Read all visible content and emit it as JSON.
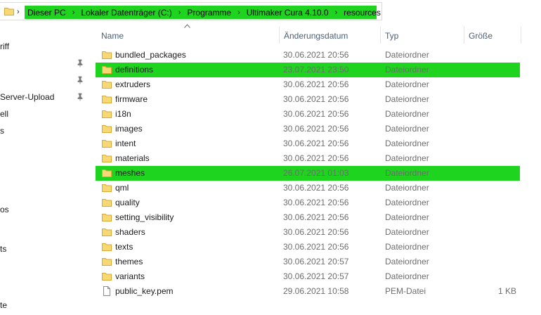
{
  "address_bar": {
    "crumbs": [
      "Dieser PC",
      "Lokaler Datenträger (C:)",
      "Programme",
      "Ultimaker Cura 4.10.0",
      "resources"
    ],
    "highlight_color": "#1ed41e"
  },
  "nav_pane": {
    "items": [
      {
        "label": "riff",
        "pinned": false
      },
      {
        "label": "",
        "pinned": true
      },
      {
        "label": "",
        "pinned": true
      },
      {
        "label": "Server-Upload",
        "pinned": true
      },
      {
        "label": "ell",
        "pinned": false
      },
      {
        "label": "s",
        "pinned": false
      },
      {
        "label": "os",
        "pinned": false
      },
      {
        "label": "ts",
        "pinned": false
      },
      {
        "label": "te",
        "pinned": false
      }
    ]
  },
  "columns": {
    "name": "Name",
    "date": "Änderungsdatum",
    "type": "Typ",
    "size": "Größe"
  },
  "files": [
    {
      "name": "bundled_packages",
      "date": "30.06.2021 20:56",
      "type": "Dateiordner",
      "size": "",
      "icon": "folder-icon",
      "highlighted": false
    },
    {
      "name": "definitions",
      "date": "23.07.2021 23:50",
      "type": "Dateiordner",
      "size": "",
      "icon": "folder-icon",
      "highlighted": true
    },
    {
      "name": "extruders",
      "date": "30.06.2021 20:56",
      "type": "Dateiordner",
      "size": "",
      "icon": "folder-icon",
      "highlighted": false
    },
    {
      "name": "firmware",
      "date": "30.06.2021 20:56",
      "type": "Dateiordner",
      "size": "",
      "icon": "folder-icon",
      "highlighted": false
    },
    {
      "name": "i18n",
      "date": "30.06.2021 20:56",
      "type": "Dateiordner",
      "size": "",
      "icon": "folder-icon",
      "highlighted": false
    },
    {
      "name": "images",
      "date": "30.06.2021 20:56",
      "type": "Dateiordner",
      "size": "",
      "icon": "folder-icon",
      "highlighted": false
    },
    {
      "name": "intent",
      "date": "30.06.2021 20:56",
      "type": "Dateiordner",
      "size": "",
      "icon": "folder-icon",
      "highlighted": false
    },
    {
      "name": "materials",
      "date": "30.06.2021 20:56",
      "type": "Dateiordner",
      "size": "",
      "icon": "folder-icon",
      "highlighted": false
    },
    {
      "name": "meshes",
      "date": "26.07.2021 01:03",
      "type": "Dateiordner",
      "size": "",
      "icon": "folder-icon",
      "highlighted": true
    },
    {
      "name": "qml",
      "date": "30.06.2021 20:56",
      "type": "Dateiordner",
      "size": "",
      "icon": "folder-icon",
      "highlighted": false
    },
    {
      "name": "quality",
      "date": "30.06.2021 20:56",
      "type": "Dateiordner",
      "size": "",
      "icon": "folder-icon",
      "highlighted": false
    },
    {
      "name": "setting_visibility",
      "date": "30.06.2021 20:56",
      "type": "Dateiordner",
      "size": "",
      "icon": "folder-icon",
      "highlighted": false
    },
    {
      "name": "shaders",
      "date": "30.06.2021 20:56",
      "type": "Dateiordner",
      "size": "",
      "icon": "folder-icon",
      "highlighted": false
    },
    {
      "name": "texts",
      "date": "30.06.2021 20:56",
      "type": "Dateiordner",
      "size": "",
      "icon": "folder-icon",
      "highlighted": false
    },
    {
      "name": "themes",
      "date": "30.06.2021 20:57",
      "type": "Dateiordner",
      "size": "",
      "icon": "folder-icon",
      "highlighted": false
    },
    {
      "name": "variants",
      "date": "30.06.2021 20:57",
      "type": "Dateiordner",
      "size": "",
      "icon": "folder-icon",
      "highlighted": false
    },
    {
      "name": "public_key.pem",
      "date": "29.06.2021 10:58",
      "type": "PEM-Datei",
      "size": "1 KB",
      "icon": "file-icon",
      "highlighted": false
    }
  ]
}
